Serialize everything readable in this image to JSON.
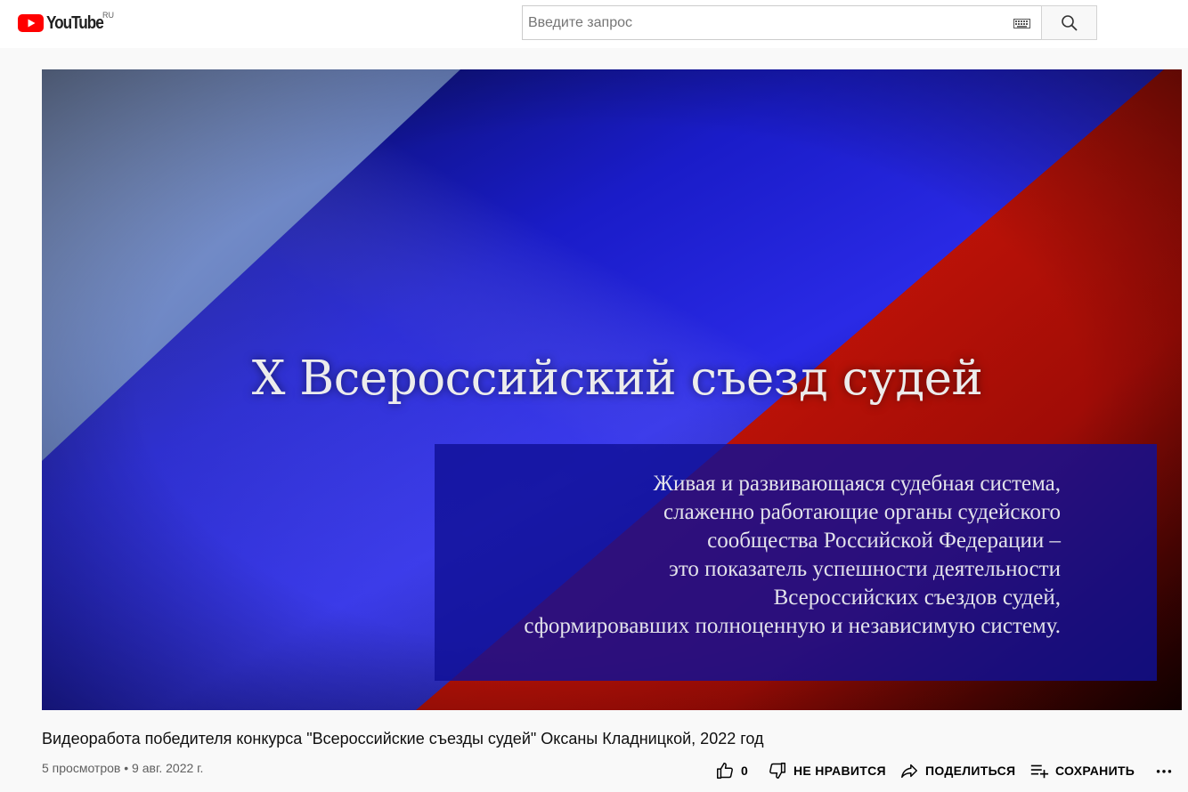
{
  "header": {
    "logo_text": "YouTube",
    "region": "RU",
    "search_placeholder": "Введите запрос",
    "brand_color": "#ff0000"
  },
  "player": {
    "title_text": "X Всероссийский съезд судей",
    "quote_lines": [
      "Живая и развивающаяся судебная система,",
      "слаженно работающие органы судейского",
      "сообщества Российской Федерации –",
      "это показатель успешности деятельности",
      "Всероссийских съездов судей,",
      "сформировавших полноценную и независимую систему."
    ]
  },
  "video": {
    "title": "Видеоработа победителя конкурса \"Всероссийские съезды судей\" Оксаны Кладницкой, 2022 год",
    "views": "5 просмотров",
    "separator": "•",
    "date": "9 авг. 2022 г."
  },
  "actions": {
    "like_count": "0",
    "dislike_label": "НЕ НРАВИТСЯ",
    "share_label": "ПОДЕЛИТЬСЯ",
    "save_label": "СОХРАНИТЬ",
    "icons": [
      "like-icon",
      "dislike-icon",
      "share-icon",
      "save-playlist-icon",
      "more-icon"
    ]
  }
}
